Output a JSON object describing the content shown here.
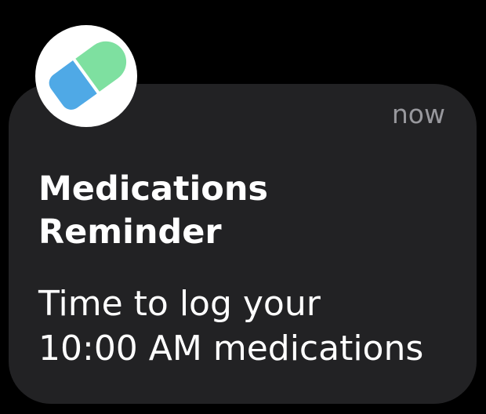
{
  "notification": {
    "app_icon": "pill-icon",
    "timestamp": "now",
    "title_lines": [
      "Medications",
      "Reminder"
    ],
    "message_lines": [
      "Time to log your",
      "10:00 AM medications"
    ]
  },
  "colors": {
    "background": "#000000",
    "card": "#222224",
    "timestamp": "#98989d",
    "text": "#ffffff",
    "pill_green": "#7ee0a0",
    "pill_blue": "#4fa9e6"
  }
}
